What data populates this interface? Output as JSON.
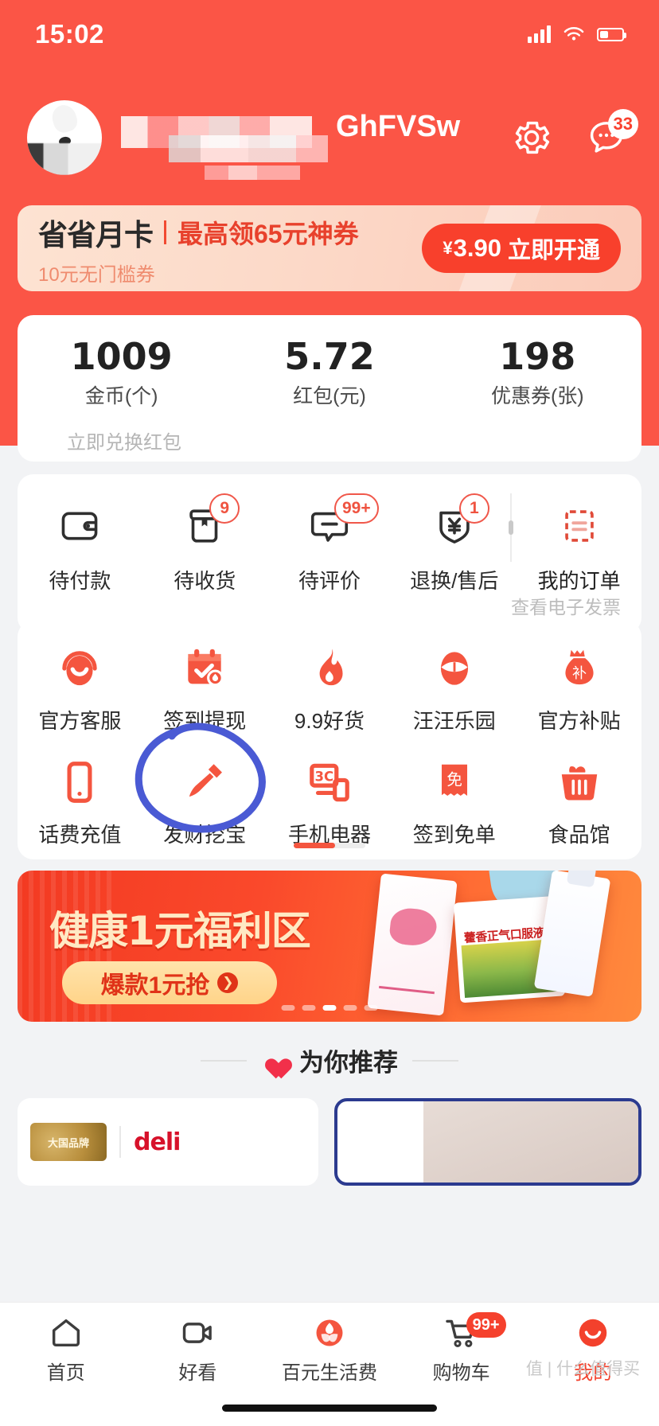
{
  "status_bar": {
    "time": "15:02",
    "signal_icon": "signal-bars-icon",
    "wifi_icon": "wifi-icon",
    "battery_icon": "battery-icon"
  },
  "header": {
    "nickname_visible": "GhFVSw",
    "settings_icon": "gear-icon",
    "message_icon": "chat-bubble-icon",
    "message_count": "33",
    "avatar_name": "jd-dog-avatar"
  },
  "month_card": {
    "title": "省省月卡",
    "subtitle": "最高领65元神券",
    "note": "10元无门槛券",
    "button_currency": "¥",
    "button_price": "3.90",
    "button_action": "立即开通"
  },
  "assets": {
    "items": [
      {
        "value": "1009",
        "label": "金币(个)"
      },
      {
        "value": "5.72",
        "label": "红包(元)"
      },
      {
        "value": "198",
        "label": "优惠券(张)"
      }
    ],
    "exchange_link": "立即兑换红包"
  },
  "orders": {
    "items": [
      {
        "label": "待付款",
        "icon": "wallet-icon",
        "badge": ""
      },
      {
        "label": "待收货",
        "icon": "package-box-icon",
        "badge": "9"
      },
      {
        "label": "待评价",
        "icon": "comment-bubble-icon",
        "badge": "99+"
      },
      {
        "label": "退换/售后",
        "icon": "yen-shield-icon",
        "badge": "1"
      },
      {
        "label": "我的订单",
        "icon": "order-list-icon",
        "badge": ""
      }
    ],
    "invoice_link": "查看电子发票"
  },
  "services": {
    "row1": [
      {
        "label": "官方客服",
        "icon": "headset-icon"
      },
      {
        "label": "签到提现",
        "icon": "calendar-check-icon"
      },
      {
        "label": "9.9好货",
        "icon": "flame-icon"
      },
      {
        "label": "汪汪乐园",
        "icon": "dog-face-icon"
      },
      {
        "label": "官方补贴",
        "icon": "money-bag-icon"
      }
    ],
    "row2": [
      {
        "label": "话费充值",
        "icon": "phone-icon"
      },
      {
        "label": "发财挖宝",
        "icon": "shovel-icon"
      },
      {
        "label": "手机电器",
        "icon": "3c-device-icon"
      },
      {
        "label": "签到免单",
        "icon": "free-coupon-icon"
      },
      {
        "label": "食品馆",
        "icon": "food-basket-icon"
      }
    ]
  },
  "annotation": {
    "shape": "hand-drawn-circle",
    "color": "#4a5ad4",
    "targets": "发财挖宝"
  },
  "promo_banner": {
    "title": "健康1元福利区",
    "button_label": "爆款1元抢",
    "arrow_icon": "chevron-right-icon",
    "dots_total": 5,
    "dots_active_index": 2,
    "product_label": "藿香正气口服液"
  },
  "recommend": {
    "title": "为你推荐",
    "heart_icon": "heart-icon"
  },
  "product_cards": {
    "left_brand_badge": "大国品牌",
    "left_brand_name": "deli"
  },
  "tabbar": {
    "items": [
      {
        "label": "首页",
        "icon": "home-icon",
        "badge": "",
        "active": false
      },
      {
        "label": "好看",
        "icon": "video-icon",
        "badge": "",
        "active": false
      },
      {
        "label": "百元生活费",
        "icon": "flower-coin-icon",
        "badge": "",
        "active": false
      },
      {
        "label": "购物车",
        "icon": "cart-icon",
        "badge": "99+",
        "active": false
      },
      {
        "label": "我的",
        "icon": "profile-circle-icon",
        "badge": "",
        "active": true
      }
    ]
  },
  "watermark": "值 | 什么值得买",
  "colors": {
    "brand_red": "#fb5546",
    "accent_red": "#f8402c",
    "annotation_blue": "#4a5ad4",
    "page_bg": "#f2f3f5"
  }
}
